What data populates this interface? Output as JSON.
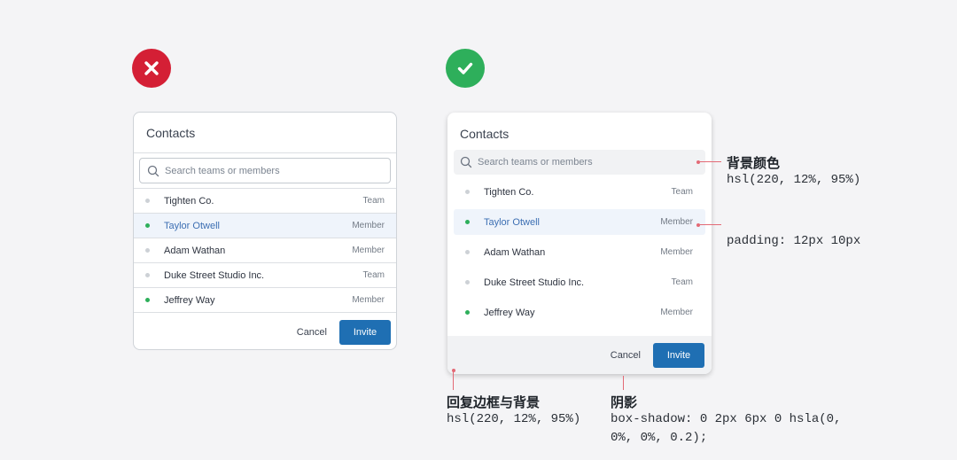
{
  "bad_dialog": {
    "title": "Contacts",
    "search_placeholder": "Search teams or members",
    "rows": [
      {
        "name": "Tighten Co.",
        "role": "Team",
        "status": "gray"
      },
      {
        "name": "Taylor Otwell",
        "role": "Member",
        "status": "green",
        "selected": true
      },
      {
        "name": "Adam Wathan",
        "role": "Member",
        "status": "gray"
      },
      {
        "name": "Duke Street Studio Inc.",
        "role": "Team",
        "status": "gray"
      },
      {
        "name": "Jeffrey Way",
        "role": "Member",
        "status": "green"
      }
    ],
    "cancel_label": "Cancel",
    "invite_label": "Invite"
  },
  "good_dialog": {
    "title": "Contacts",
    "search_placeholder": "Search teams or members",
    "rows": [
      {
        "name": "Tighten Co.",
        "role": "Team",
        "status": "gray"
      },
      {
        "name": "Taylor Otwell",
        "role": "Member",
        "status": "green",
        "selected": true
      },
      {
        "name": "Adam Wathan",
        "role": "Member",
        "status": "gray"
      },
      {
        "name": "Duke Street Studio Inc.",
        "role": "Team",
        "status": "gray"
      },
      {
        "name": "Jeffrey Way",
        "role": "Member",
        "status": "green"
      }
    ],
    "cancel_label": "Cancel",
    "invite_label": "Invite"
  },
  "annotations": {
    "bg_color_title": "背景颜色",
    "bg_color_value": "hsl(220, 12%, 95%)",
    "padding_value": "padding: 12px 10px",
    "border_bg_title": "回复边框与背景",
    "border_bg_value": "hsl(220, 12%, 95%)",
    "shadow_title": "阴影",
    "shadow_value_line1": "box-shadow: 0 2px 6px 0 hsla(0,",
    "shadow_value_line2": "0%, 0%, 0.2);"
  },
  "colors": {
    "bad": "#d41f35",
    "good": "#2eaf5b",
    "accent": "#1f6fb3",
    "annotation": "#e36a76",
    "selected_bg": "#eff4fb"
  }
}
